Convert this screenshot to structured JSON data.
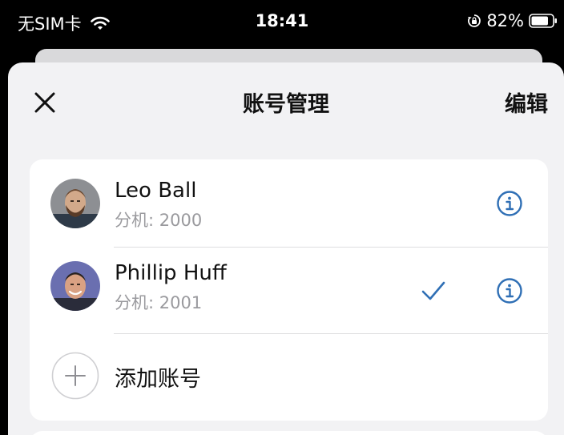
{
  "status_bar": {
    "carrier": "无SIM卡",
    "time": "18:41",
    "battery_percent": "82%",
    "battery_level": 0.82
  },
  "nav": {
    "title": "账号管理",
    "edit_label": "编辑",
    "close_icon": "close-icon"
  },
  "accounts": [
    {
      "name": "Leo Ball",
      "extension": "分机: 2000",
      "selected": false
    },
    {
      "name": "Phillip Huff",
      "extension": "分机: 2001",
      "selected": true
    }
  ],
  "add_account": {
    "label": "添加账号",
    "icon": "plus-icon"
  },
  "colors": {
    "accent": "#2f6fb5",
    "sheet_bg": "#f2f2f4",
    "card_bg": "#ffffff",
    "secondary_text": "#9a9a9e"
  }
}
